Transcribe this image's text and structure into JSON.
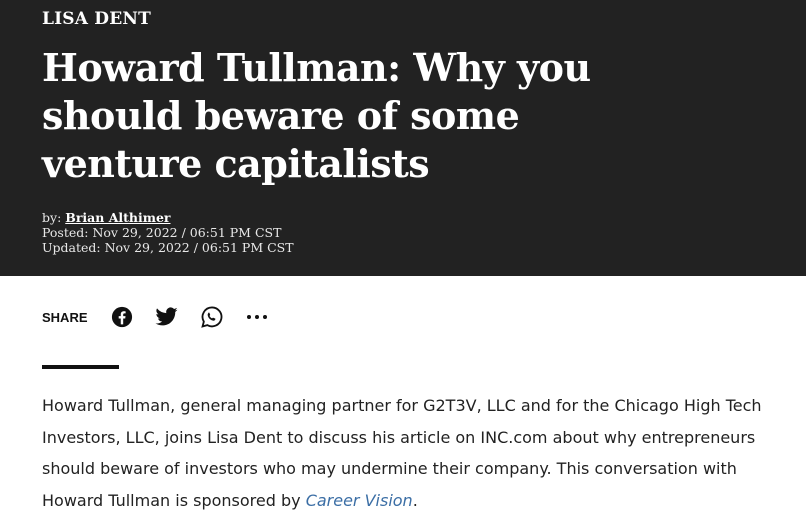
{
  "kicker": "LISA DENT",
  "headline": "Howard Tullman: Why you should beware of some venture capitalists",
  "meta": {
    "by_prefix": "by: ",
    "author": "Brian Althimer",
    "posted": "Posted: Nov 29, 2022 / 06:51 PM CST",
    "updated": "Updated: Nov 29, 2022 / 06:51 PM CST"
  },
  "share": {
    "label": "SHARE",
    "icons": [
      "facebook-icon",
      "twitter-icon",
      "whatsapp-icon",
      "more-icon"
    ]
  },
  "body": {
    "text_before_link": "Howard Tullman, general managing partner for G2T3V, LLC and for the Chicago High Tech Investors, LLC, joins Lisa Dent to discuss his article on INC.com about why entrepreneurs should beware of investors who may undermine their company. This conversation with Howard Tullman is sponsored by ",
    "link_text": "Career Vision",
    "text_after_link": "."
  },
  "colors": {
    "hero_bg": "#222222",
    "link": "#3b6ea5"
  }
}
